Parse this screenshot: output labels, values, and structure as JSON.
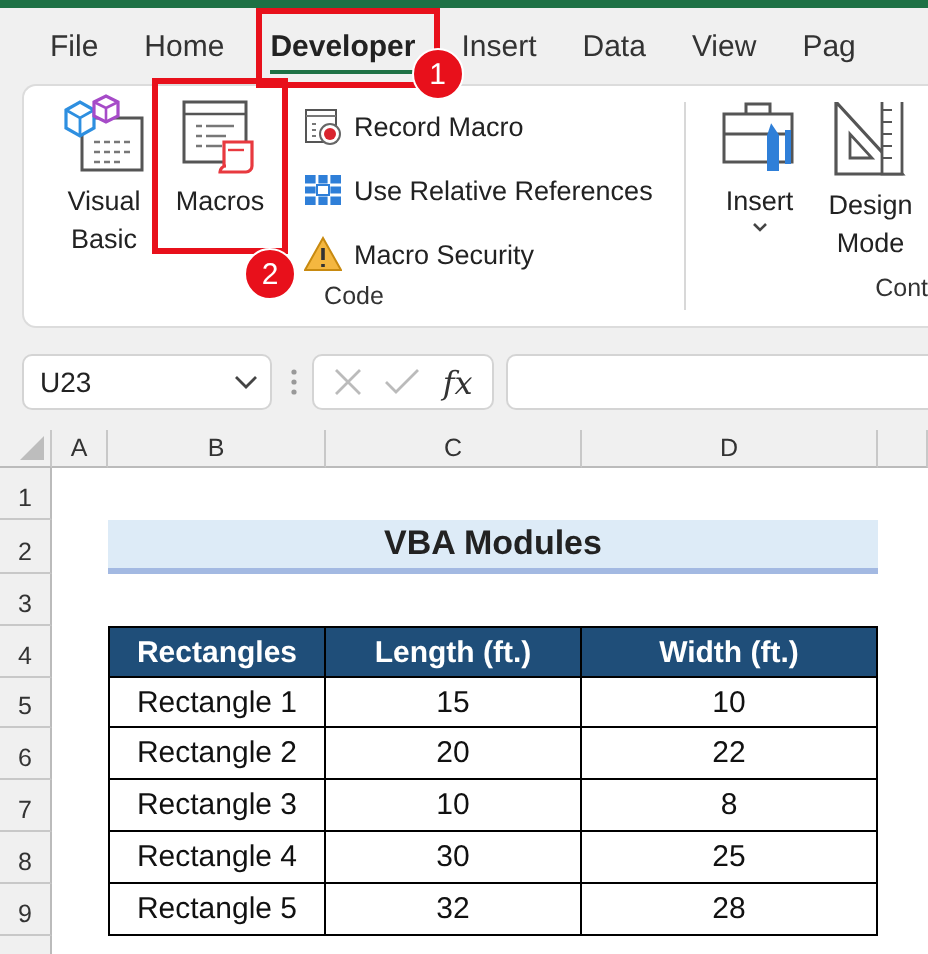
{
  "ribbon": {
    "tabs": [
      {
        "label": "File",
        "selected": false
      },
      {
        "label": "Home",
        "selected": false
      },
      {
        "label": "Developer",
        "selected": true,
        "callout": "1"
      },
      {
        "label": "Insert",
        "selected": false
      },
      {
        "label": "Data",
        "selected": false
      },
      {
        "label": "View",
        "selected": false
      },
      {
        "label": "Pag",
        "selected": false
      }
    ],
    "groups": [
      {
        "label": "Code",
        "large_buttons": [
          {
            "label": "Visual Basic"
          },
          {
            "label": "Macros",
            "callout": "2"
          }
        ],
        "small_buttons": [
          {
            "label": "Record Macro"
          },
          {
            "label": "Use Relative References"
          },
          {
            "label": "Macro Security"
          }
        ]
      },
      {
        "label": "Cont",
        "large_buttons": [
          {
            "label": "Insert",
            "has_menu": true
          },
          {
            "label": "Design Mode"
          }
        ]
      }
    ]
  },
  "formula_bar": {
    "name_box": "U23",
    "function_label": "fx"
  },
  "sheet": {
    "columns": [
      "A",
      "B",
      "C",
      "D"
    ],
    "rows": [
      "1",
      "2",
      "3",
      "4",
      "5",
      "6",
      "7",
      "8",
      "9"
    ],
    "title": "VBA Modules",
    "table": {
      "columns": [
        "Rectangles",
        "Length (ft.)",
        "Width (ft.)"
      ],
      "rows": [
        [
          "Rectangle 1",
          "15",
          "10"
        ],
        [
          "Rectangle 2",
          "20",
          "22"
        ],
        [
          "Rectangle 3",
          "10",
          "8"
        ],
        [
          "Rectangle 4",
          "30",
          "25"
        ],
        [
          "Rectangle 5",
          "32",
          "28"
        ]
      ]
    }
  }
}
